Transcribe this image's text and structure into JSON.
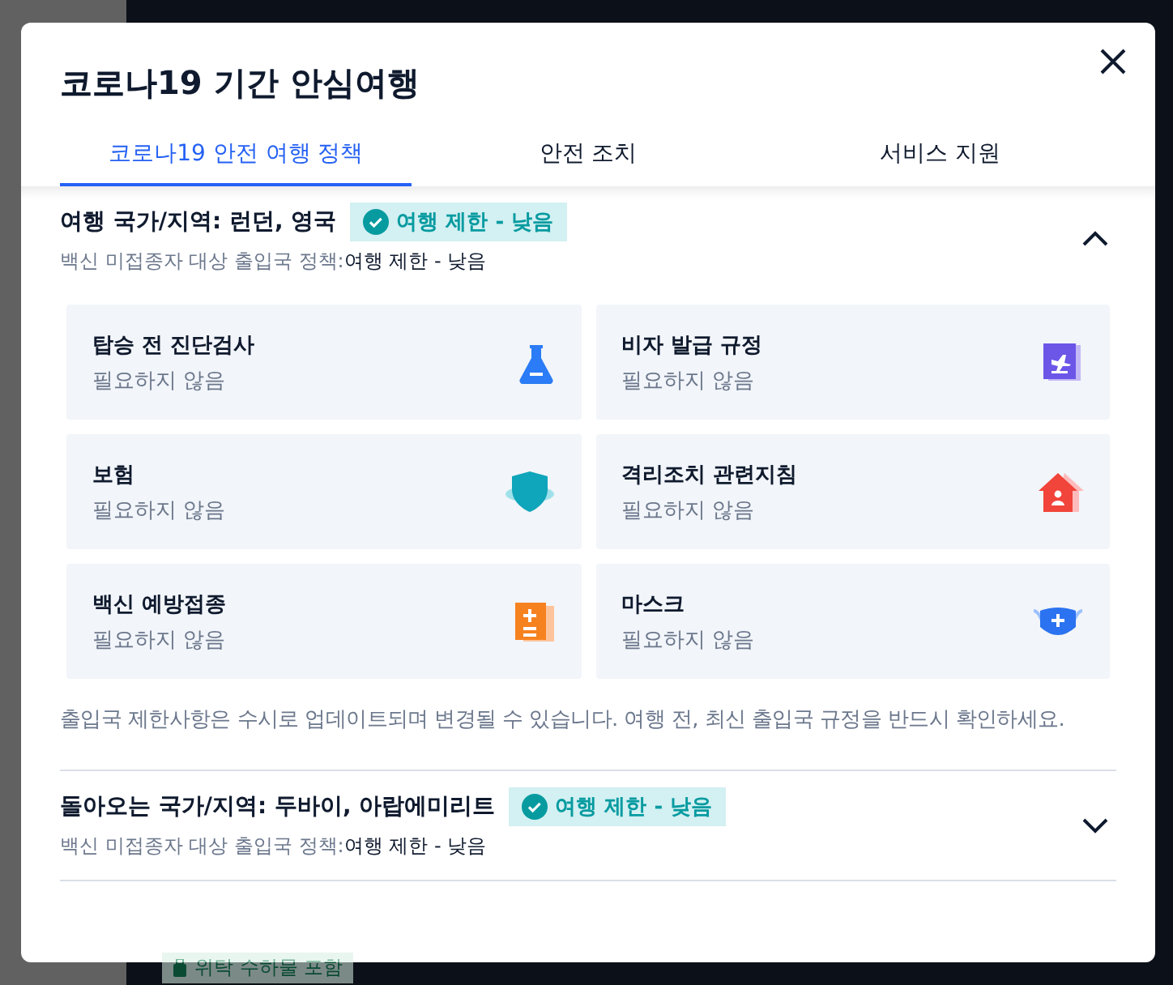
{
  "background": {
    "baggage_badge": "위탁 수하물 포함"
  },
  "modal": {
    "title": "코로나19 기간 안심여행",
    "tabs": [
      {
        "label": "코로나19 안전 여행 정책",
        "selected": true
      },
      {
        "label": "안전 조치",
        "selected": false
      },
      {
        "label": "서비스 지원",
        "selected": false
      }
    ],
    "sections": [
      {
        "heading": "여행 국가/지역: 런던, 영국",
        "badge": "여행 제한 - 낮음",
        "policy_label": "백신 미접종자 대상 출입국 정책:",
        "policy_value": "여행 제한 - 낮음",
        "expanded": true,
        "cards": [
          {
            "title": "탑승 전 진단검사",
            "status": "필요하지 않음"
          },
          {
            "title": "비자 발급 규정",
            "status": "필요하지 않음"
          },
          {
            "title": "보험",
            "status": "필요하지 않음"
          },
          {
            "title": "격리조치 관련지침",
            "status": "필요하지 않음"
          },
          {
            "title": "백신 예방접종",
            "status": "필요하지 않음"
          },
          {
            "title": "마스크",
            "status": "필요하지 않음"
          }
        ],
        "note": "출입국 제한사항은 수시로 업데이트되며 변경될 수 있습니다. 여행 전, 최신 출입국 규정을 반드시 확인하세요."
      },
      {
        "heading": "돌아오는 국가/지역: 두바이, 아랍에미리트",
        "badge": "여행 제한 - 낮음",
        "policy_label": "백신 미접종자 대상 출입국 정책:",
        "policy_value": "여행 제한 - 낮음",
        "expanded": false
      }
    ]
  }
}
